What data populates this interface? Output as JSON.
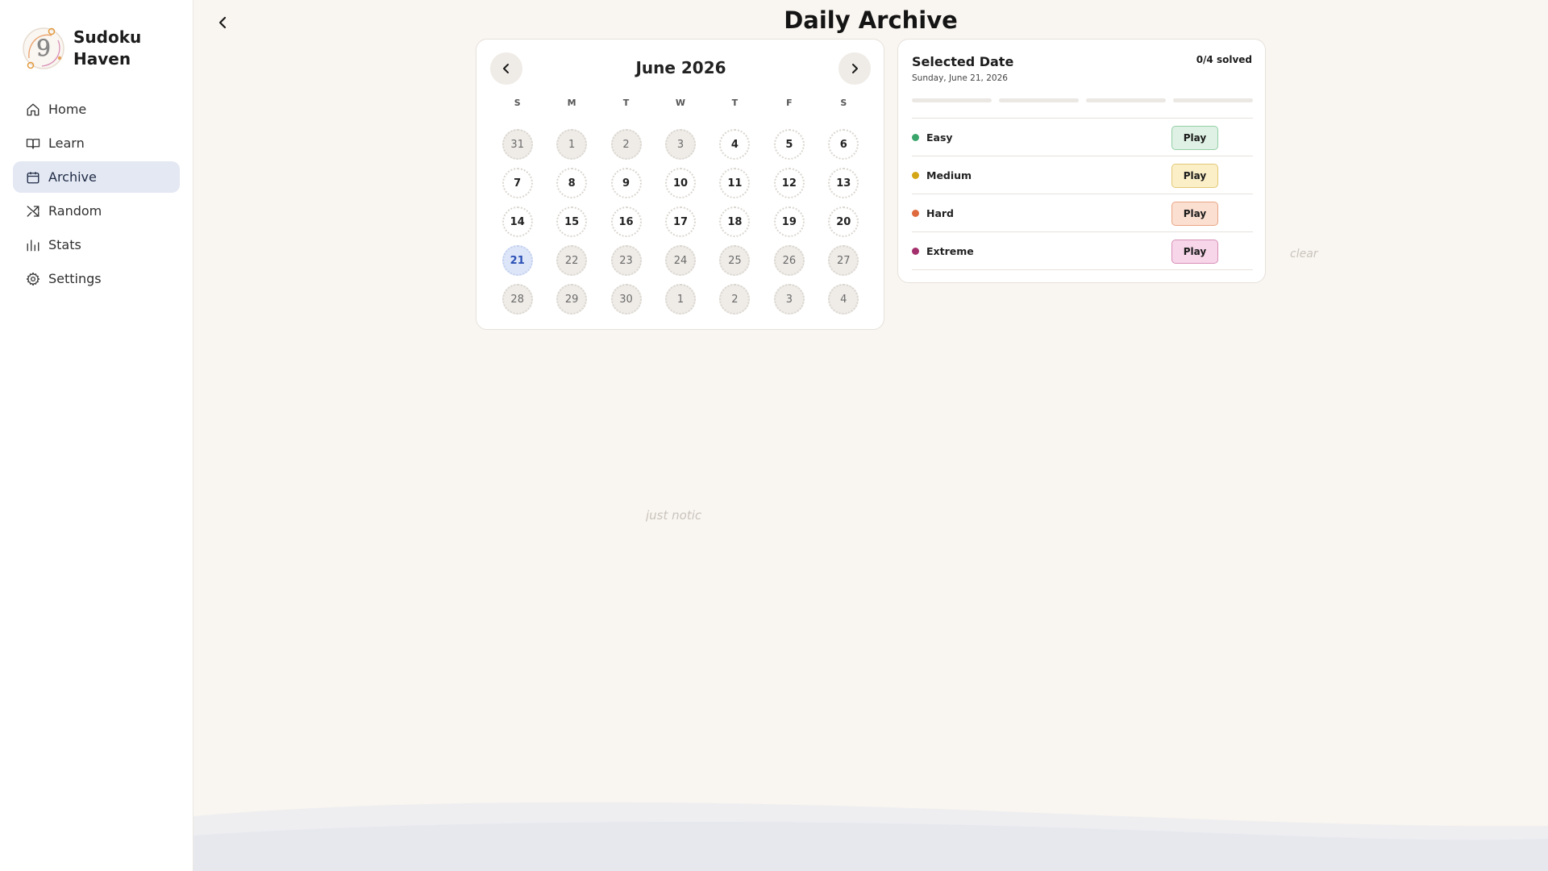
{
  "brand": {
    "name": "Sudoku Haven",
    "logo_icon": "sudoku-nine-logo-icon"
  },
  "sidebar": {
    "items": [
      {
        "label": "Home",
        "icon": "home-icon",
        "active": false
      },
      {
        "label": "Learn",
        "icon": "book-icon",
        "active": false
      },
      {
        "label": "Archive",
        "icon": "calendar-icon",
        "active": true
      },
      {
        "label": "Random",
        "icon": "shuffle-icon",
        "active": false
      },
      {
        "label": "Stats",
        "icon": "bar-chart-icon",
        "active": false
      },
      {
        "label": "Settings",
        "icon": "gear-icon",
        "active": false
      }
    ]
  },
  "header": {
    "title": "Daily Archive",
    "back_icon": "chevron-left-icon"
  },
  "calendar": {
    "month_label": "June 2026",
    "prev_icon": "chevron-left-icon",
    "next_icon": "chevron-right-icon",
    "weekdays": [
      "S",
      "M",
      "T",
      "W",
      "T",
      "F",
      "S"
    ],
    "days": [
      {
        "n": "31",
        "state": "muted"
      },
      {
        "n": "1",
        "state": "muted"
      },
      {
        "n": "2",
        "state": "muted"
      },
      {
        "n": "3",
        "state": "muted"
      },
      {
        "n": "4",
        "state": "normal"
      },
      {
        "n": "5",
        "state": "normal"
      },
      {
        "n": "6",
        "state": "normal"
      },
      {
        "n": "7",
        "state": "normal"
      },
      {
        "n": "8",
        "state": "normal"
      },
      {
        "n": "9",
        "state": "normal"
      },
      {
        "n": "10",
        "state": "normal"
      },
      {
        "n": "11",
        "state": "normal"
      },
      {
        "n": "12",
        "state": "normal"
      },
      {
        "n": "13",
        "state": "normal"
      },
      {
        "n": "14",
        "state": "normal"
      },
      {
        "n": "15",
        "state": "normal"
      },
      {
        "n": "16",
        "state": "normal"
      },
      {
        "n": "17",
        "state": "normal"
      },
      {
        "n": "18",
        "state": "normal"
      },
      {
        "n": "19",
        "state": "normal"
      },
      {
        "n": "20",
        "state": "normal"
      },
      {
        "n": "21",
        "state": "selected"
      },
      {
        "n": "22",
        "state": "muted"
      },
      {
        "n": "23",
        "state": "muted"
      },
      {
        "n": "24",
        "state": "muted"
      },
      {
        "n": "25",
        "state": "muted"
      },
      {
        "n": "26",
        "state": "muted"
      },
      {
        "n": "27",
        "state": "muted"
      },
      {
        "n": "28",
        "state": "muted"
      },
      {
        "n": "29",
        "state": "muted"
      },
      {
        "n": "30",
        "state": "muted"
      },
      {
        "n": "1",
        "state": "muted"
      },
      {
        "n": "2",
        "state": "muted"
      },
      {
        "n": "3",
        "state": "muted"
      },
      {
        "n": "4",
        "state": "muted"
      }
    ]
  },
  "selected": {
    "title": "Selected Date",
    "date_text": "Sunday, June 21, 2026",
    "solved_text": "0/4 solved",
    "progress_segments": 4,
    "difficulties": [
      {
        "name": "Easy",
        "dot_color": "#3aa56b",
        "button": "Play",
        "btn_bg": "#dff1e4",
        "btn_border": "#93cfa7"
      },
      {
        "name": "Medium",
        "dot_color": "#d4a514",
        "button": "Play",
        "btn_bg": "#fbefc7",
        "btn_border": "#e3c877"
      },
      {
        "name": "Hard",
        "dot_color": "#de6a3e",
        "button": "Play",
        "btn_bg": "#fbdfd1",
        "btn_border": "#e9a585"
      },
      {
        "name": "Extreme",
        "dot_color": "#a3306c",
        "button": "Play",
        "btn_bg": "#f6d6e8",
        "btn_border": "#d98fb8"
      }
    ]
  },
  "ghost_notes": {
    "note1": "just notic",
    "note2": "clear"
  },
  "colors": {
    "background": "#f9f5f0",
    "accent": "#2a4fb6",
    "wave": "#e8e9ee"
  }
}
